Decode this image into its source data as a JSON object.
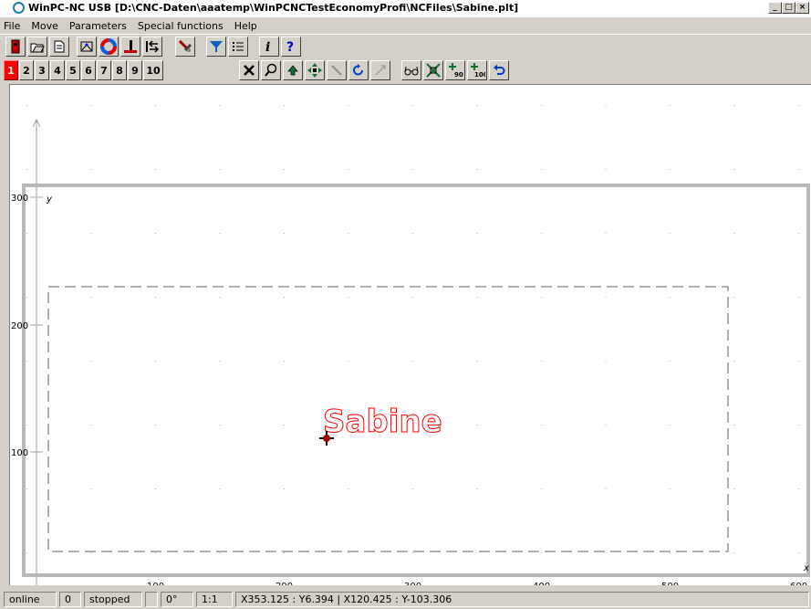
{
  "window": {
    "title": "WinPC-NC USB [D:\\CNC-Daten\\aaatemp\\WinPCNCTestEconomyProfi\\NCFiles\\Sabine.plt]",
    "min": "_",
    "max": "□",
    "close": "×"
  },
  "menu": [
    "File",
    "Move",
    "Parameters",
    "Special functions",
    "Help"
  ],
  "toolbar1": {
    "icons": [
      "exit-icon",
      "open-file-icon",
      "file-info-icon",
      "hardware-check-icon",
      "color-wheel-icon",
      "tool-length-icon",
      "reference-run-icon",
      "tool-change-icon",
      "filter-icon",
      "list-icon",
      "info-icon",
      "help-icon"
    ]
  },
  "toolbar2": {
    "numbers": [
      "1",
      "2",
      "3",
      "4",
      "5",
      "6",
      "7",
      "8",
      "9",
      "10"
    ],
    "active_number": "1",
    "icons": [
      "cancel-icon",
      "zoom-icon",
      "move-up-icon",
      "move-all-icon",
      "wand-icon",
      "rotate-icon",
      "disabled-move-icon",
      "glasses-icon",
      "scale-icon",
      "rotate-90-icon",
      "rotate-100-icon",
      "undo-icon"
    ]
  },
  "canvas": {
    "x_ticks": [
      "100",
      "200",
      "300",
      "400",
      "500",
      "600"
    ],
    "y_ticks": [
      "300",
      "200",
      "100"
    ],
    "y_axis_label": "y",
    "x_axis_label": "x",
    "drawing_text": "Sabine",
    "drawing_color": "#ff0000"
  },
  "status": {
    "connection": "online",
    "count": "0",
    "state": "stopped",
    "angle": "0°",
    "scale": "1:1",
    "coords": "X353.125 : Y6.394  |  X120.425 : Y-103.306"
  }
}
